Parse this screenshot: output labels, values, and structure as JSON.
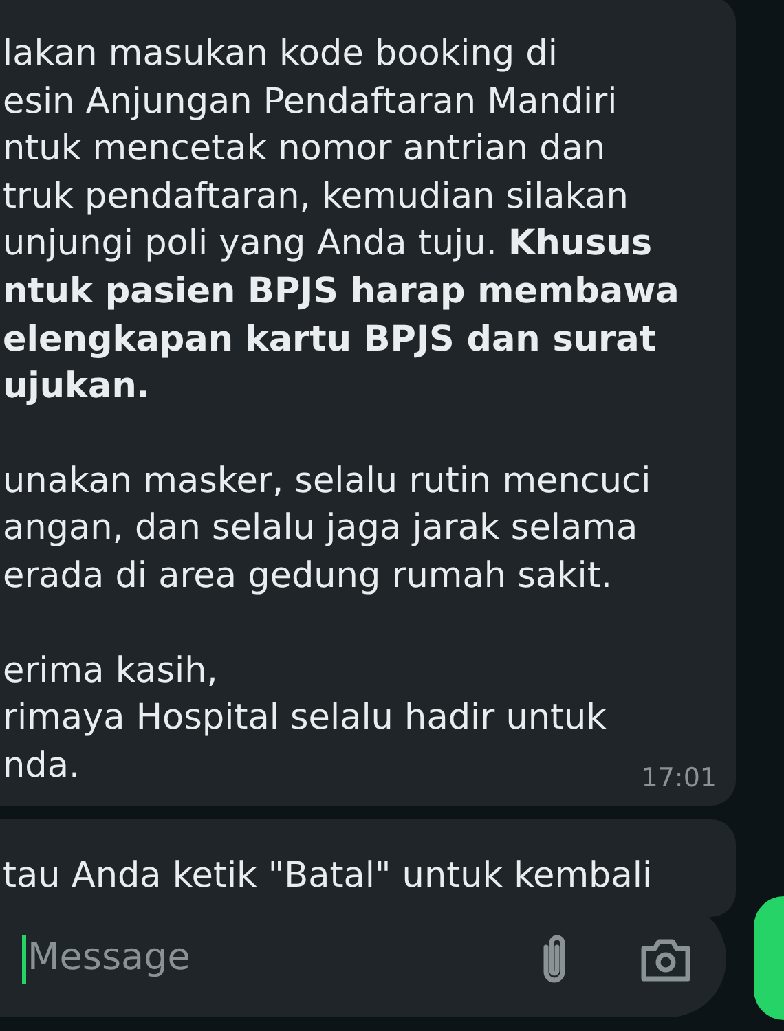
{
  "messages": [
    {
      "kind": "text",
      "paragraphs": [
        [
          "lakan masukan kode booking di",
          "esin Anjungan Pendaftaran Mandiri",
          "ntuk mencetak nomor antrian dan",
          "truk pendaftaran, kemudian silakan",
          "unjungi poli yang Anda tuju. **Khusus**",
          "**ntuk pasien BPJS harap membawa**",
          "**elengkapan kartu BPJS dan surat**",
          "**ujukan.**"
        ],
        [
          "unakan masker, selalu rutin mencuci",
          "angan, dan selalu jaga jarak selama",
          "erada di area gedung rumah sakit."
        ],
        [
          "erima kasih,",
          "rimaya Hospital selalu hadir untuk",
          "nda."
        ]
      ],
      "time": "17:01"
    },
    {
      "kind": "text",
      "paragraphs": [
        [
          "tau Anda ketik \"Batal\" untuk kembali"
        ]
      ]
    }
  ],
  "composer": {
    "placeholder": "Message"
  }
}
